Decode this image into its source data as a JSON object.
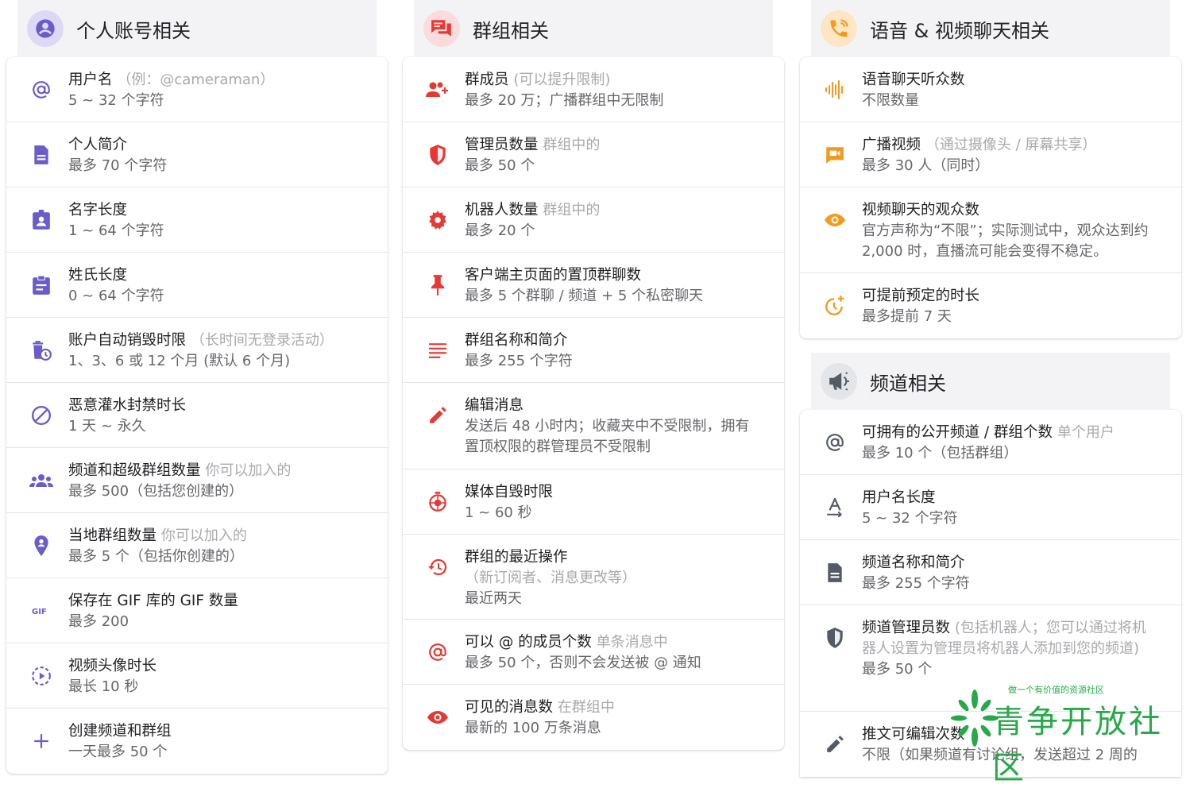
{
  "colors": {
    "purple": "#6a5cc9",
    "red": "#e53935",
    "orange": "#f29a1d",
    "gray": "#555b66",
    "purple_bg": "#ddd9f5",
    "red_bg": "#fbdcdc",
    "orange_bg": "#fde6c6",
    "gray_bg": "#e3e5e9"
  },
  "columns": [
    {
      "title": "个人账号相关",
      "icon": "account-circle-icon",
      "items": [
        {
          "icon": "at-sign-icon",
          "label": "用户名",
          "hint": "（例：@cameraman）",
          "value": "5 ~ 32 个字符"
        },
        {
          "icon": "document-icon",
          "label": "个人简介",
          "hint": "",
          "value": "最多 70 个字符"
        },
        {
          "icon": "badge-icon",
          "label": "名字长度",
          "hint": "",
          "value": "1 ~ 64 个字符"
        },
        {
          "icon": "clipboard-icon",
          "label": "姓氏长度",
          "hint": "",
          "value": "0 ~ 64 个字符"
        },
        {
          "icon": "delete-timer-icon",
          "label": "账户自动销毁时限",
          "hint": "（长时间无登录活动）",
          "value": "1、3、6 或 12 个月 (默认 6 个月)"
        },
        {
          "icon": "block-icon",
          "label": "恶意灌水封禁时长",
          "hint": "",
          "value": "1 天 ~ 永久"
        },
        {
          "icon": "groups-icon",
          "label": "频道和超级群组数量",
          "hint": "你可以加入的",
          "value": "最多 500（包括您创建的）"
        },
        {
          "icon": "location-pin-icon",
          "label": "当地群组数量",
          "hint": "你可以加入的",
          "value": "最多 5 个（包括你创建的）"
        },
        {
          "icon": "gif-icon",
          "label": "保存在 GIF 库的 GIF 数量",
          "hint": "",
          "value": "最多 200"
        },
        {
          "icon": "video-avatar-icon",
          "label": "视频头像时长",
          "hint": "",
          "value": "最长 10 秒"
        },
        {
          "icon": "plus-icon",
          "label": "创建频道和群组",
          "hint": "",
          "value": "一天最多 50 个"
        }
      ]
    },
    {
      "title": "群组相关",
      "icon": "chat-bubbles-icon",
      "items": [
        {
          "icon": "add-member-icon",
          "label": "群成员",
          "hint": "(可以提升限制)",
          "value": "最多 20 万；广播群组中无限制"
        },
        {
          "icon": "shield-icon",
          "label": "管理员数量",
          "hint": "群组中的",
          "value": "最多 50 个"
        },
        {
          "icon": "gear-icon",
          "label": "机器人数量",
          "hint": "群组中的",
          "value": "最多 20 个"
        },
        {
          "icon": "pin-icon",
          "label": "客户端主页面的置顶群聊数",
          "hint": "",
          "value": "最多 5 个群聊 / 频道 + 5 个私密聊天"
        },
        {
          "icon": "text-lines-icon",
          "label": "群组名称和简介",
          "hint": "",
          "value": "最多 255 个字符"
        },
        {
          "icon": "pencil-icon",
          "label": "编辑消息",
          "hint": "",
          "value": "发送后 48 小时内；收藏夹中不受限制，拥有置顶权限的群管理员不受限制"
        },
        {
          "icon": "self-destruct-timer-icon",
          "label": "媒体自毁时限",
          "hint": "",
          "value": "1 ~ 60 秒"
        },
        {
          "icon": "history-icon",
          "label": "群组的最近操作",
          "hint": "（新订阅者、消息更改等）",
          "value": "最近两天"
        },
        {
          "icon": "at-sign-icon",
          "label": "可以 @ 的成员个数",
          "hint": "单条消息中",
          "value": "最多 50 个，否则不会发送被 @ 通知"
        },
        {
          "icon": "eye-icon",
          "label": "可见的消息数",
          "hint": "在群组中",
          "value": "最新的 100 万条消息"
        }
      ]
    },
    {
      "title": "语音 & 视频聊天相关",
      "icon": "phone-call-icon",
      "items": [
        {
          "icon": "voice-wave-icon",
          "label": "语音聊天听众数",
          "hint": "",
          "value": "不限数量"
        },
        {
          "icon": "video-broadcast-icon",
          "label": "广播视频",
          "hint": "（通过摄像头 / 屏幕共享）",
          "value": "最多 30 人（同时）"
        },
        {
          "icon": "eye-icon",
          "label": "视频聊天的观众数",
          "hint": "",
          "value": "官方声称为“不限”；实际测试中，观众达到约 2,000 时，直播流可能会变得不稳定。"
        },
        {
          "icon": "schedule-timer-icon",
          "label": "可提前预定的时长",
          "hint": "",
          "value": "最多提前 7 天"
        }
      ]
    },
    {
      "title": "频道相关",
      "icon": "megaphone-icon",
      "items": [
        {
          "icon": "at-sign-icon",
          "label": "可拥有的公开频道 / 群组个数",
          "hint": "单个用户",
          "value": "最多 10 个（包括群组）"
        },
        {
          "icon": "font-size-icon",
          "label": "用户名长度",
          "hint": "",
          "value": "5 ~ 32 个字符"
        },
        {
          "icon": "document-icon",
          "label": "频道名称和简介",
          "hint": "",
          "value": "最多 255 个字符"
        },
        {
          "icon": "shield-icon",
          "label": "频道管理员数",
          "hint": "(包括机器人；您可以通过将机器人设置为管理员将机器人添加到您的频道)",
          "value": "最多 50 个"
        },
        {
          "icon": "pencil-icon",
          "label": "推文可编辑次数",
          "hint": "",
          "value": "不限（如果频道有讨论组，发送超过 2 周的"
        }
      ]
    }
  ],
  "watermark": {
    "slogan": "做一个有价值的资源社区",
    "name": "青争开放社区"
  }
}
